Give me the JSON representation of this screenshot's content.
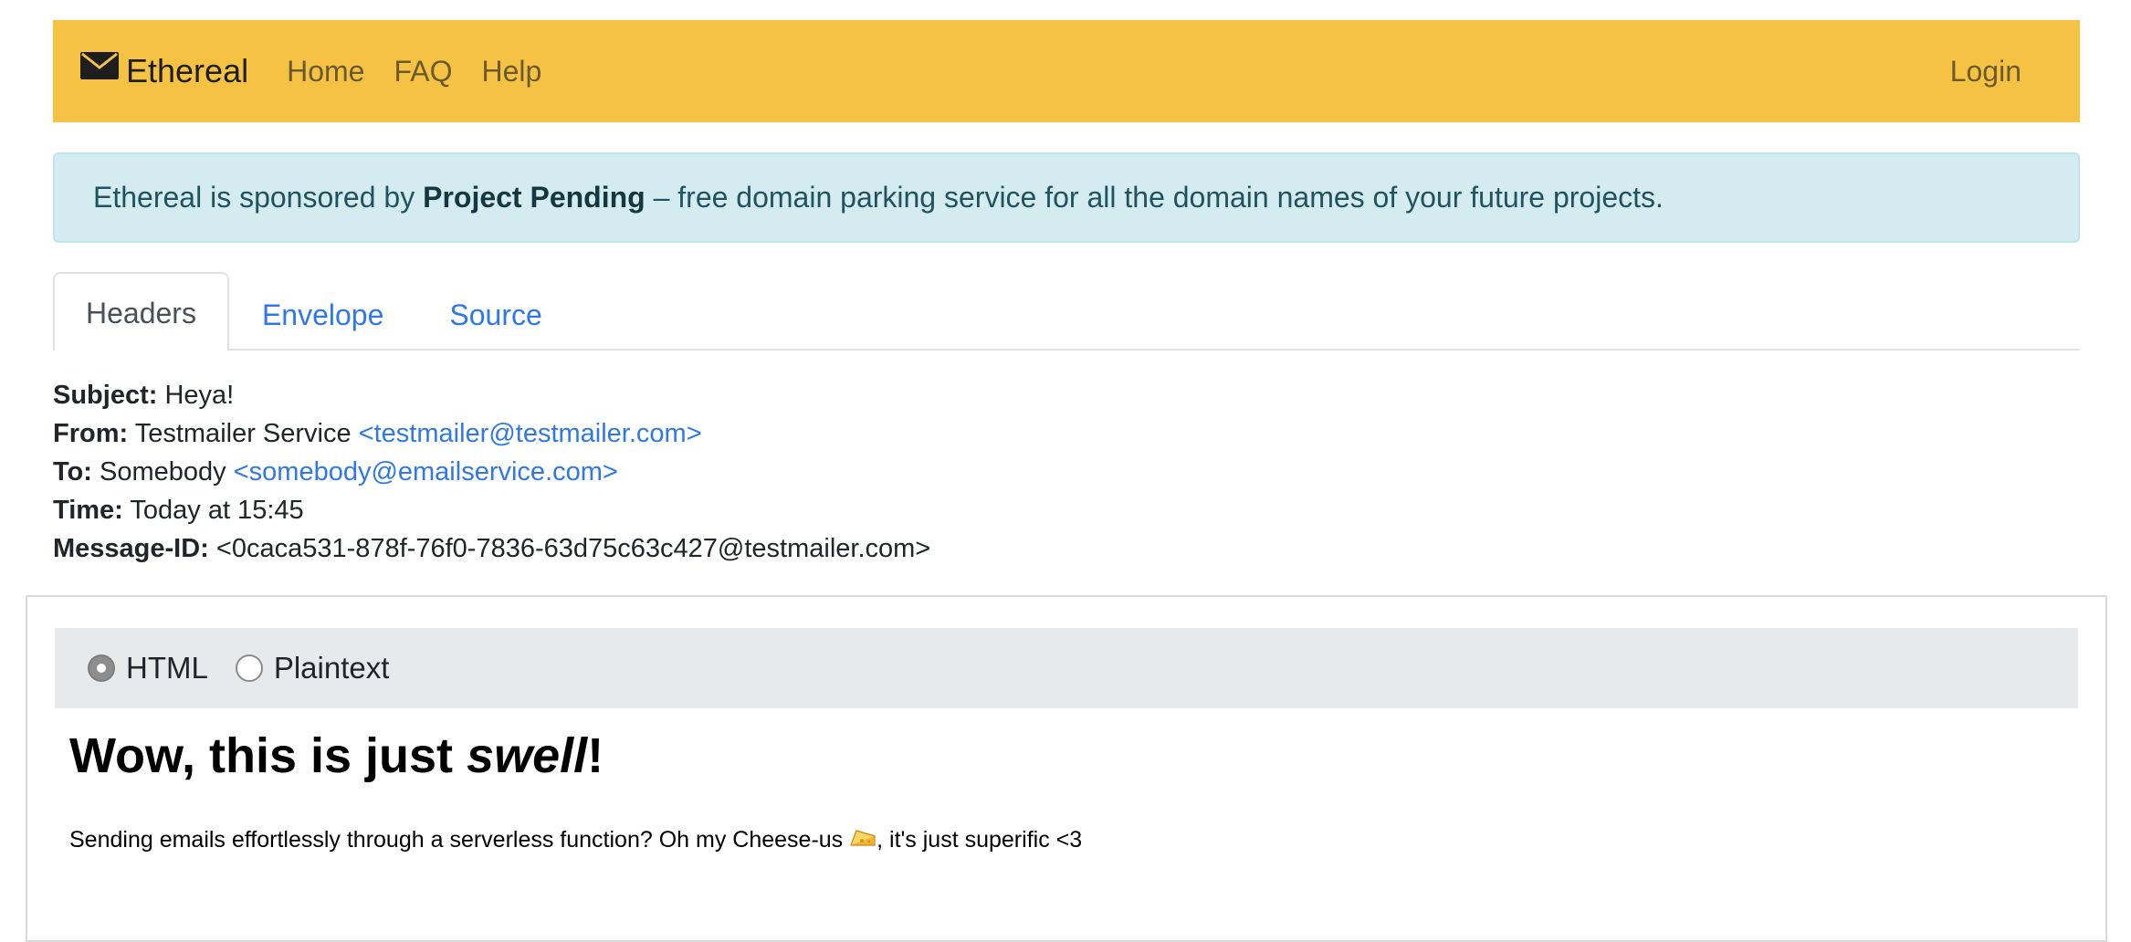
{
  "navbar": {
    "brand": "Ethereal",
    "links": [
      "Home",
      "FAQ",
      "Help"
    ],
    "login": "Login",
    "bg_color": "#f5c244"
  },
  "alert": {
    "prefix": "Ethereal is sponsored by ",
    "sponsor": "Project Pending",
    "suffix": " – free domain parking service for all the domain names of your future projects."
  },
  "tabs": [
    {
      "label": "Headers",
      "active": true
    },
    {
      "label": "Envelope",
      "active": false
    },
    {
      "label": "Source",
      "active": false
    }
  ],
  "headers": {
    "subject": {
      "label": "Subject:",
      "value": "Heya!"
    },
    "from": {
      "label": "From:",
      "name": "Testmailer Service",
      "address": "<testmailer@testmailer.com>"
    },
    "to": {
      "label": "To:",
      "name": "Somebody",
      "address": "<somebody@emailservice.com>"
    },
    "time": {
      "label": "Time:",
      "value": "Today at 15:45"
    },
    "message_id": {
      "label": "Message-ID:",
      "value": "<0caca531-878f-76f0-7836-63d75c63c427@testmailer.com>"
    }
  },
  "view_toggle": {
    "options": [
      "HTML",
      "Plaintext"
    ],
    "selected": "HTML"
  },
  "email": {
    "heading_prefix": "Wow, this is just ",
    "heading_emphasis": "swell",
    "heading_suffix": "!",
    "body_before": "Sending emails effortlessly through a serverless function? Oh my Cheese-us ",
    "body_icon": "cheese-icon",
    "body_after": ", it's just superific <3"
  }
}
